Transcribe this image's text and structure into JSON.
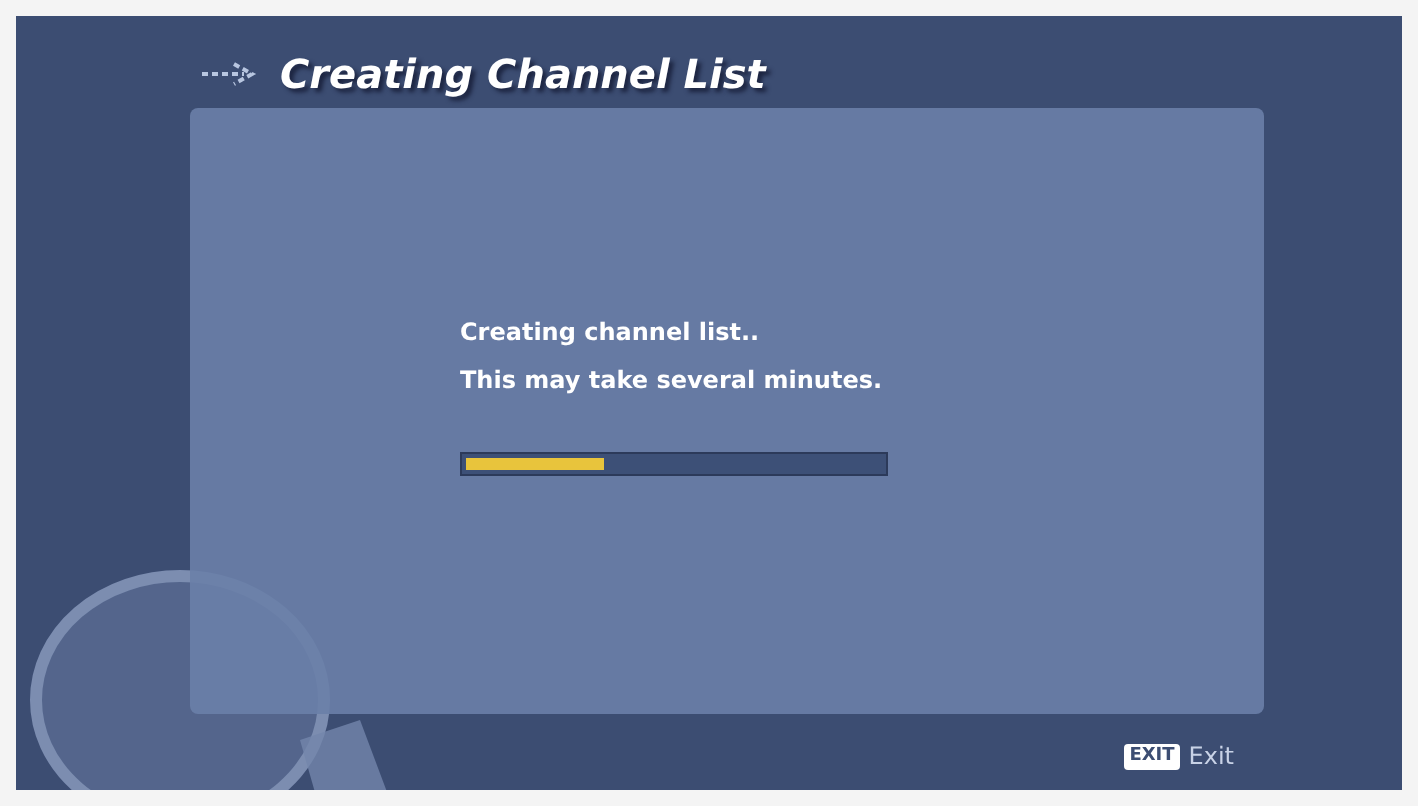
{
  "title": "Creating Channel List",
  "messages": [
    "Creating channel list..",
    "This may take several minutes."
  ],
  "progress": {
    "level": 0.33
  },
  "footer": {
    "key": "EXIT",
    "label": "Exit"
  }
}
